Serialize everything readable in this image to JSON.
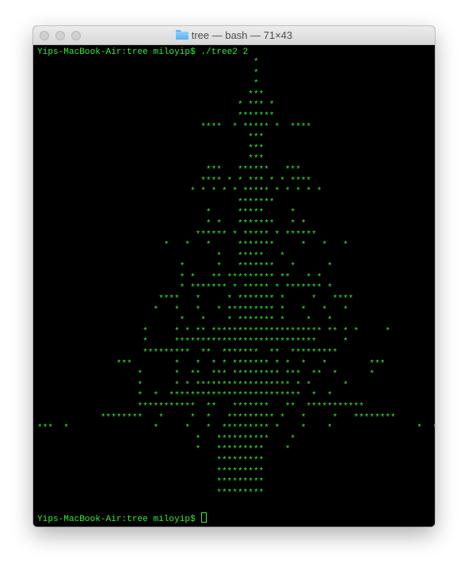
{
  "window": {
    "title": "tree — bash — 71×43"
  },
  "terminal": {
    "command_line": "Yips-MacBook-Air:tree miloyip$ ./tree2 2",
    "output": "                                         *\n                                         *\n                                         *\n                                        ***\n                                      * *** *\n                                      *******\n                               ****  * ***** *  ****\n                                        ***\n                                        ***\n                                        ***\n                                ***   ******   ***\n                               **** * * *** * * ****\n                             * * * * * ***** * * * * *\n                                      *******\n                                *     *****     *\n                                * *   *******   * *\n                              ****** * ***** * ******\n                        *   *   *     *******     *   *   *\n                                  *   *****   *\n                           *      *   *******   *      *\n                           * *   ** ********* **   * *\n                           * ******* * ***** * ******* *\n                       ****   *     * ******* *     *   ****\n                      *   *   *   * ********* *   *   *   *\n                           *   *    * ******* *    *   *\n                    *     * * ** ********************* ** * *     *\n                    *     ***************************     *\n                    *********  **  *******  **  *********\n               ***        *   *  * * ******* * *  *   *        ***\n                   *      *  **  *** ********* ***  **  *      *\n                   *      * * ****************** * *      *\n                   *  *  *************************  *  *\n                   ***********  **   *******   **  ***********\n            ********   *     *  *   ********* *   *     *   ********\n***  *                *     *   *  ********* *    *    *                *  ***\n                              *   **********    *\n                              *   *********    *\n                                  *********\n                                  *********\n                                  *********\n                                  *********",
    "prompt": "Yips-MacBook-Air:tree miloyip$ "
  },
  "colors": {
    "terminal_text": "#33ee33",
    "terminal_background": "#000000"
  },
  "icons": {
    "title_icon": "folder-icon"
  }
}
